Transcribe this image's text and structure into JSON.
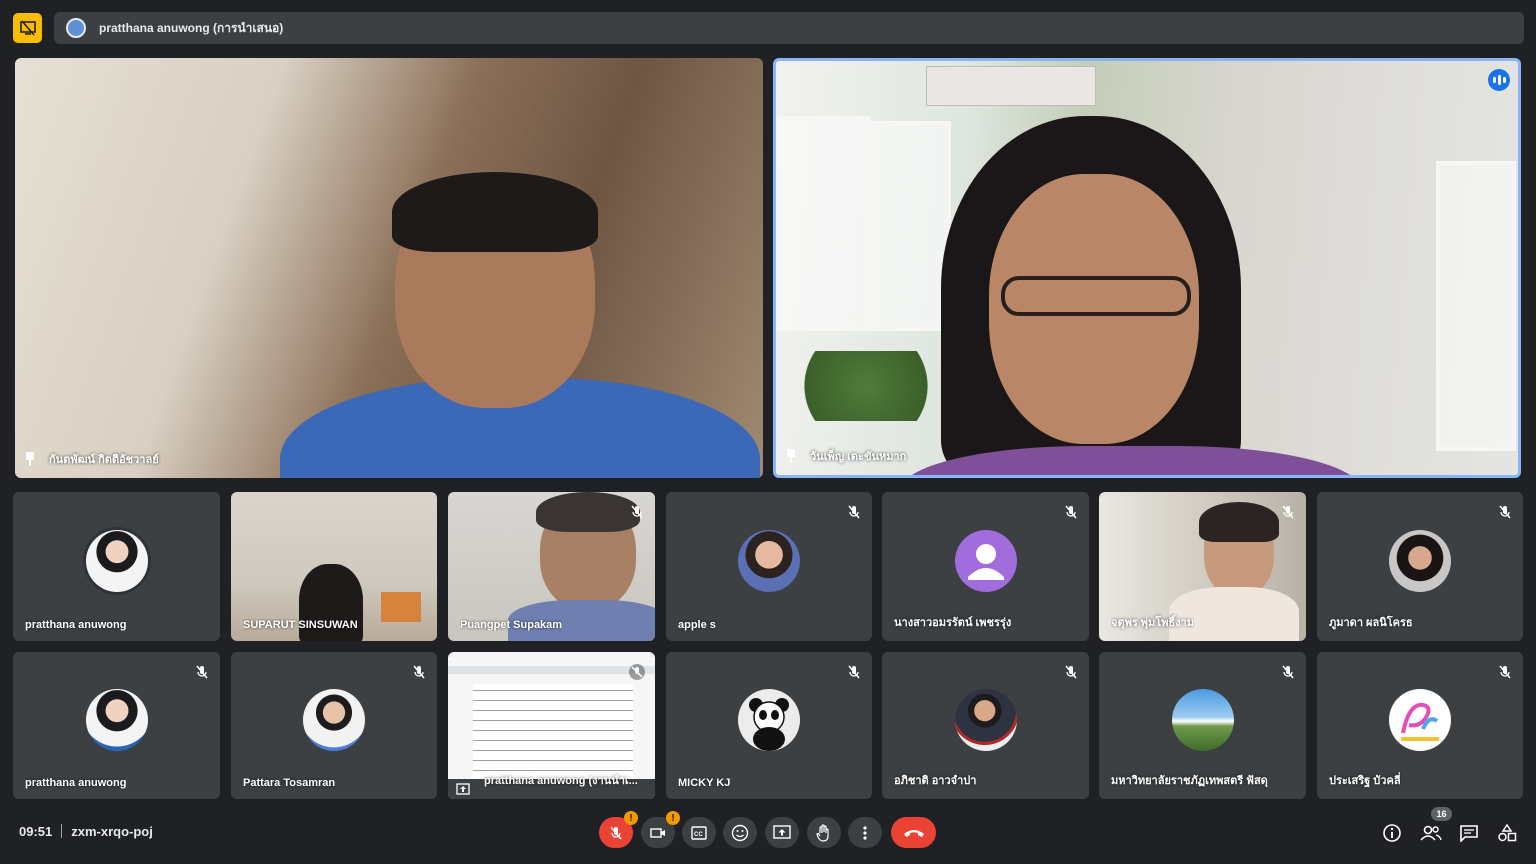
{
  "topbar": {
    "presenter_text": "pratthana anuwong (การนำเสนอ)"
  },
  "main_tiles": [
    {
      "name": "กันตพัฒน์ กิตติอัชวาลย์",
      "pinned": true
    },
    {
      "name": "วันเพ็ญ เตะขันหมาก",
      "pinned": true,
      "speaking": true
    }
  ],
  "grid_tiles": [
    {
      "name": "pratthana anuwong",
      "muted": false,
      "kind": "avatar-photo"
    },
    {
      "name": "SUPARUT SINSUWAN",
      "muted": false,
      "kind": "video"
    },
    {
      "name": "Puangpet Supakam",
      "muted": true,
      "kind": "video"
    },
    {
      "name": "apple s",
      "muted": true,
      "kind": "avatar-photo"
    },
    {
      "name": "นางสาวอมรรัตน์ เพชรรุ่ง",
      "muted": true,
      "kind": "avatar-generic"
    },
    {
      "name": "จตุพร พุ่มโพธิ์งาม",
      "muted": true,
      "kind": "video"
    },
    {
      "name": "ภูมาดา ผลนิโครธ",
      "muted": true,
      "kind": "avatar-photo"
    },
    {
      "name": "pratthana anuwong",
      "muted": true,
      "kind": "avatar-photo"
    },
    {
      "name": "Pattara Tosamran",
      "muted": true,
      "kind": "avatar-photo"
    },
    {
      "name": "pratthana anuwong (งานนำเ...",
      "muted": true,
      "kind": "presentation"
    },
    {
      "name": "MICKY KJ",
      "muted": true,
      "kind": "avatar-panda"
    },
    {
      "name": "อภิชาติ อาวจำปา",
      "muted": true,
      "kind": "avatar-photo"
    },
    {
      "name": "มหาวิทยาลัยราชภัฏเทพสตรี ฟัสดุ",
      "muted": true,
      "kind": "avatar-landscape"
    },
    {
      "name": "ประเสริฐ บัวคลี่",
      "muted": true,
      "kind": "avatar-logo"
    }
  ],
  "bottombar": {
    "time": "09:51",
    "meeting_code": "zxm-xrqo-poj",
    "participant_count": "16",
    "controls": [
      "mic-off-icon",
      "camera-off-icon",
      "captions-icon",
      "emoji-icon",
      "present-icon",
      "raise-hand-icon",
      "more-icon",
      "end-call-icon"
    ],
    "right_controls": [
      "info-icon",
      "people-icon",
      "chat-icon",
      "activities-icon"
    ]
  },
  "colors": {
    "background": "#202124",
    "tile": "#3c4043",
    "accent": "#8ab4f8",
    "present": "#fbbc04",
    "danger": "#ea4335",
    "warning": "#f29900"
  }
}
